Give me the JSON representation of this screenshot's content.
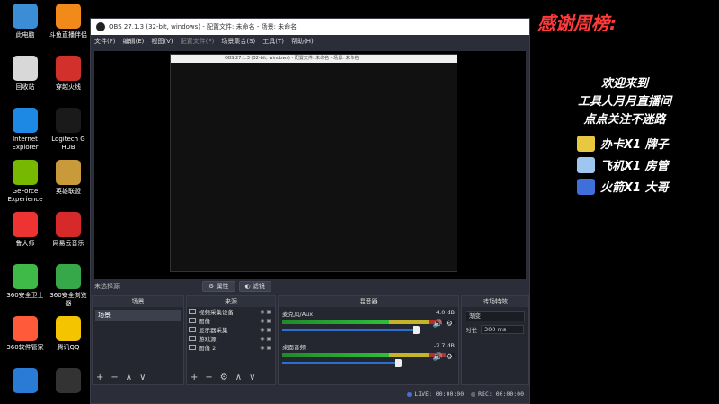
{
  "desktop": {
    "icons": [
      {
        "label": "此电脑",
        "color": "#3b8ed6"
      },
      {
        "label": "斗鱼直播伴侣",
        "color": "#f28a1b"
      },
      {
        "label": "回收站",
        "color": "#d8d8d8"
      },
      {
        "label": "穿越火线",
        "color": "#d2302a"
      },
      {
        "label": "Internet Explorer",
        "color": "#1e88e5"
      },
      {
        "label": "Logitech G HUB",
        "color": "#1a1a1a"
      },
      {
        "label": "GeForce Experience",
        "color": "#76b900"
      },
      {
        "label": "英雄联盟",
        "color": "#c99a3a"
      },
      {
        "label": "鲁大师",
        "color": "#e33"
      },
      {
        "label": "网易云音乐",
        "color": "#d62a2a"
      },
      {
        "label": "360安全卫士",
        "color": "#3fba48"
      },
      {
        "label": "360安全浏览器",
        "color": "#36a84a"
      },
      {
        "label": "360软件管家",
        "color": "#ff5a3a"
      },
      {
        "label": "腾讯QQ",
        "color": "#f5c400"
      },
      {
        "label": "",
        "color": "#2a7bd5"
      },
      {
        "label": "",
        "color": "#333"
      }
    ]
  },
  "obs": {
    "title": "OBS 27.1.3 (32-bit, windows) - 配置文件: 未命名 - 场景: 未命名",
    "menu": [
      "文件(F)",
      "编辑(E)",
      "视图(V)",
      "配置文件(P)",
      "场景集合(S)",
      "工具(T)",
      "帮助(H)"
    ],
    "no_source": "未选择源",
    "properties_btn": "属性",
    "filters_btn": "滤镜",
    "docks": {
      "scenes": {
        "title": "场景",
        "items": [
          "场景"
        ]
      },
      "sources": {
        "title": "来源",
        "items": [
          "视频采集设备",
          "图像",
          "显示器采集",
          "游戏源",
          "图像 2"
        ]
      },
      "mixer": {
        "title": "混音器",
        "channels": [
          {
            "name": "麦克风/Aux",
            "db": "4.0 dB"
          },
          {
            "name": "桌面音频",
            "db": "-2.7 dB"
          }
        ]
      },
      "transitions": {
        "title": "转场特效",
        "selected": "渐变",
        "duration_label": "时长",
        "duration": "300 ms"
      }
    },
    "status": {
      "live": "LIVE: 00:00:00",
      "rec": "REC: 00:00:00"
    }
  },
  "overlay": {
    "title": "感谢周榜:",
    "line1": "欢迎来到",
    "line2": "工具人月月直播间",
    "line3": "点点关注不迷路",
    "badges": [
      {
        "text": "办卡X1 牌子",
        "color": "#e8c840"
      },
      {
        "text": "飞机X1 房管",
        "color": "#9ec6f0"
      },
      {
        "text": "火箭X1 大哥",
        "color": "#3f6fd8"
      }
    ]
  }
}
